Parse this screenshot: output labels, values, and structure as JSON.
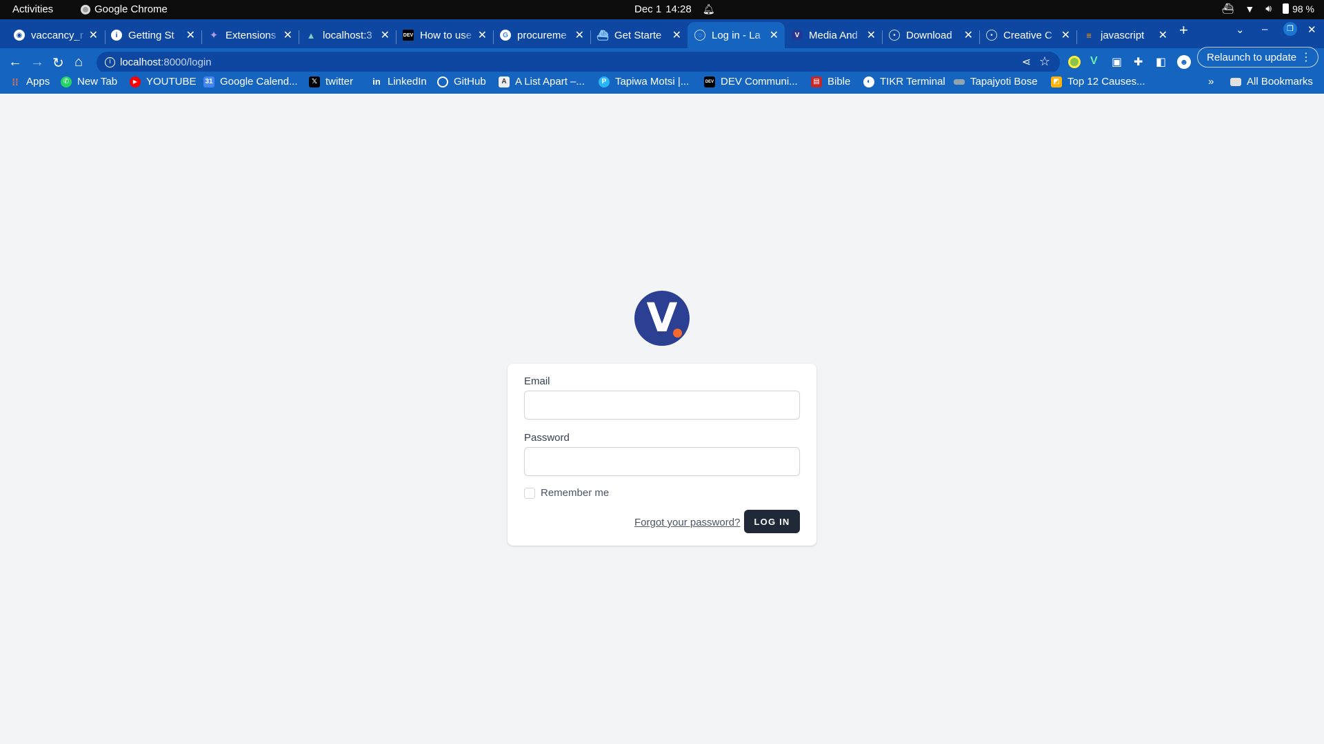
{
  "system_bar": {
    "activities": "Activities",
    "app_name": "Google Chrome",
    "date": "Dec 1",
    "time": "14:28",
    "battery": "98 %"
  },
  "tabs": [
    {
      "title": "vaccancy_r",
      "icon": "github-icon",
      "active": false
    },
    {
      "title": "Getting St",
      "icon": "info-icon",
      "active": false
    },
    {
      "title": "Extensions",
      "icon": "sparkle-icon",
      "active": false
    },
    {
      "title": "localhost:3",
      "icon": "vue-icon",
      "active": false
    },
    {
      "title": "How to use",
      "icon": "dev-icon",
      "active": false
    },
    {
      "title": "procureme",
      "icon": "google-icon",
      "active": false
    },
    {
      "title": "Get Starte",
      "icon": "docker-icon",
      "active": false
    },
    {
      "title": "Log in - La",
      "icon": "globe-icon",
      "active": true
    },
    {
      "title": "Media And",
      "icon": "v-icon",
      "active": false
    },
    {
      "title": "Download",
      "icon": "download-icon",
      "active": false
    },
    {
      "title": "Creative C",
      "icon": "cc-icon",
      "active": false
    },
    {
      "title": "javascript",
      "icon": "stackoverflow-icon",
      "active": false
    }
  ],
  "omnibox": {
    "host": "localhost",
    "path": ":8000/login"
  },
  "relaunch_label": "Relaunch to update",
  "bookmarks": [
    {
      "label": "Apps",
      "icon": "apps-grid-icon",
      "color": "#ea4335"
    },
    {
      "label": "New Tab",
      "icon": "whatsapp-icon",
      "color": "#25d366"
    },
    {
      "label": "YOUTUBE",
      "icon": "youtube-icon",
      "color": "#ff0000"
    },
    {
      "label": "Google Calend...",
      "icon": "calendar-icon",
      "color": "#4285f4"
    },
    {
      "label": "twitter",
      "icon": "x-icon",
      "color": "#000000"
    },
    {
      "label": "LinkedIn",
      "icon": "linkedin-icon",
      "color": "#0a66c2"
    },
    {
      "label": "GitHub",
      "icon": "github-icon",
      "color": "#24292f"
    },
    {
      "label": "A List Apart –...",
      "icon": "ala-icon",
      "color": "#555555"
    },
    {
      "label": "Tapiwa Motsi |...",
      "icon": "profile-icon",
      "color": "#29b6f6"
    },
    {
      "label": "DEV Communi...",
      "icon": "dev-icon",
      "color": "#000000"
    },
    {
      "label": "Bible",
      "icon": "bible-icon",
      "color": "#c62828"
    },
    {
      "label": "TIKR Terminal",
      "icon": "tikr-icon",
      "color": "#ffffff"
    },
    {
      "label": "Tapajyoti Bose",
      "icon": "blog-icon",
      "color": "#90a4ae"
    },
    {
      "label": "Top 12 Causes...",
      "icon": "article-icon",
      "color": "#ffb300"
    }
  ],
  "all_bookmarks": "All Bookmarks",
  "login": {
    "email_label": "Email",
    "email_value": "",
    "password_label": "Password",
    "password_value": "",
    "remember_label": "Remember me",
    "forgot_label": "Forgot your password?",
    "submit_label": "LOG IN",
    "logo_letter": "V"
  },
  "colors": {
    "chrome_tabstrip": "#0d47a1",
    "chrome_toolbar": "#1565c0",
    "page_bg": "#f3f4f6",
    "logo_bg": "#2b3f93",
    "logo_dot": "#f26a2e",
    "button_bg": "#1f2937"
  }
}
